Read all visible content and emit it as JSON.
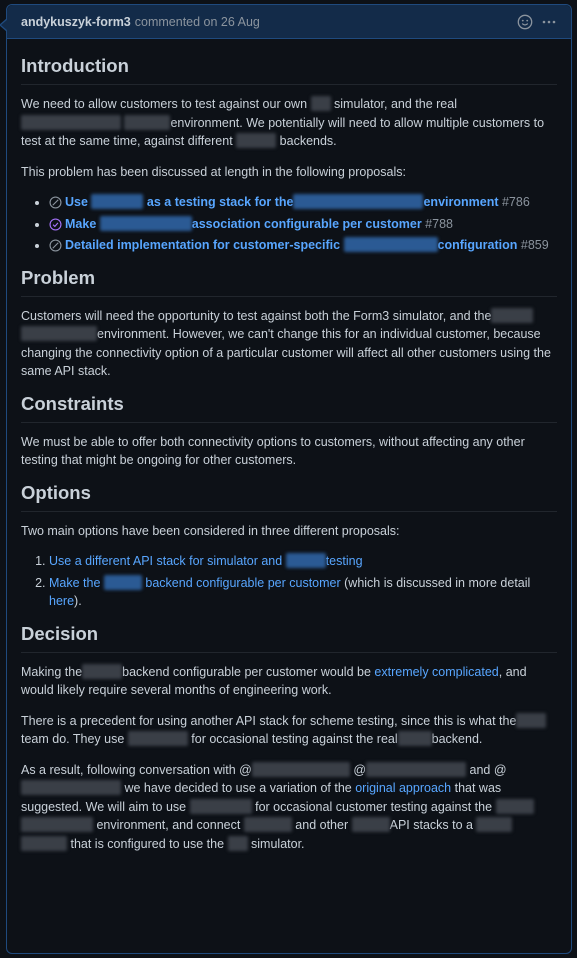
{
  "comment": {
    "author": "andykuszyk-form3",
    "meta": "commented on 26 Aug",
    "actions": {
      "reaction_icon": "smiley-icon",
      "menu_icon": "kebab-horizontal-icon"
    }
  },
  "sections": {
    "introduction": {
      "heading": "Introduction",
      "p1": [
        "We need to allow customers to test against our own",
        "simulator, and the real",
        "environment. We potentially will need to allow multiple customers to test at the same time, against different",
        "backends."
      ],
      "p2": "This problem has been discussed at length in the following proposals:",
      "proposals": [
        {
          "parts": [
            "Use",
            "as a testing stack for the",
            "environment"
          ],
          "number": "#786",
          "state": "closed",
          "icon": "skip-circle-icon"
        },
        {
          "parts": [
            "Make",
            "association configurable per customer"
          ],
          "number": "#788",
          "state": "merged",
          "icon": "check-circle-icon"
        },
        {
          "parts": [
            "Detailed implementation for customer-specific",
            "configuration"
          ],
          "number": "#859",
          "state": "closed",
          "icon": "skip-circle-icon"
        }
      ]
    },
    "problem": {
      "heading": "Problem",
      "p1": [
        "Customers will need the opportunity to test against both the Form3 simulator, and the",
        "environment. However, we can't change this for an individual customer, because changing the connectivity option of a particular customer will affect all other customers using the same API stack."
      ]
    },
    "constraints": {
      "heading": "Constraints",
      "p1": "We must be able to offer both connectivity options to customers, without affecting any other testing that might be ongoing for other customers."
    },
    "options": {
      "heading": "Options",
      "p1": "Two main options have been considered in three different proposals:",
      "items": [
        {
          "parts": [
            "Use a different API stack for simulator and",
            "testing"
          ]
        },
        {
          "parts": [
            "Make the",
            "backend configurable per customer"
          ],
          "suffix": " (which is discussed in more detail ",
          "link2": "here",
          "end": ")."
        }
      ]
    },
    "decision": {
      "heading": "Decision",
      "p1": [
        "Making the",
        "backend configurable per customer would be",
        "extremely complicated",
        ", and would likely require several months of engineering work."
      ],
      "p2": [
        "There is a precedent for using another API stack for scheme testing, since this is what the",
        "team do. They use",
        "for occasional testing against the real",
        "backend."
      ],
      "p3": [
        "As a result, following conversation with @",
        "@",
        "and @",
        "we have decided to use a variation of the",
        "original approach",
        "that was suggested. We will aim to use",
        "for occasional customer testing against the",
        "environment, and connect",
        "and other",
        "API stacks to a",
        "that is configured to use the",
        "simulator."
      ]
    }
  },
  "colors": {
    "link": "#58a6ff",
    "merged": "#a371f7",
    "border": "#1f4a7e",
    "header_bg": "#132b49"
  }
}
